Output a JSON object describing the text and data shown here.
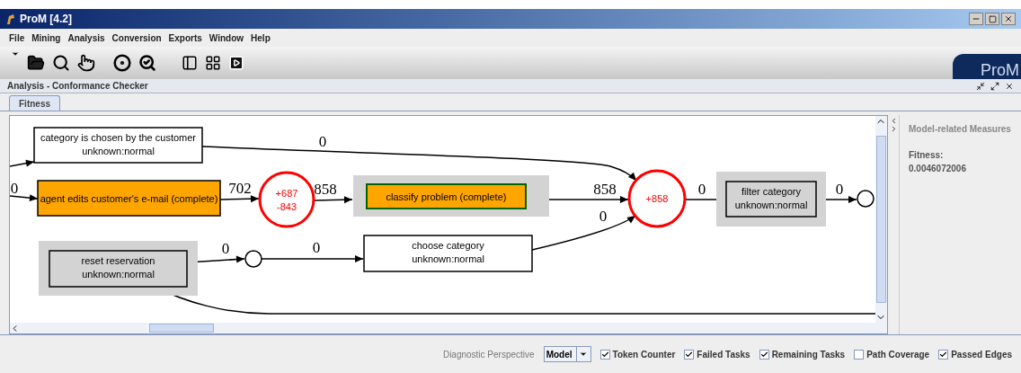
{
  "window": {
    "title": "ProM [4.2]"
  },
  "menu": [
    "File",
    "Mining",
    "Analysis",
    "Conversion",
    "Exports",
    "Window",
    "Help"
  ],
  "logo": "ProM",
  "frame": {
    "title": "Analysis - Conformance Checker"
  },
  "tabs": [
    {
      "label": "Fitness",
      "selected": true
    }
  ],
  "graph": {
    "transitions": [
      {
        "name": "category is chosen by the customer",
        "status": "unknown:normal",
        "failed": false,
        "remaining": false,
        "outlined": false
      },
      {
        "name": "agent edits customer's e-mail (complete)",
        "failed": true,
        "remaining": false,
        "outlined": false
      },
      {
        "name": "classify problem (complete)",
        "failed": true,
        "remaining": true,
        "outlined": true
      },
      {
        "name": "filter category",
        "status": "unknown:normal",
        "failed": false,
        "remaining": true,
        "outlined": false
      },
      {
        "name": "reset reservation",
        "status": "unknown:normal",
        "failed": false,
        "remaining": true,
        "outlined": false
      },
      {
        "name": "choose category",
        "status": "unknown:normal",
        "failed": false,
        "remaining": false,
        "outlined": false
      }
    ],
    "places": [
      {
        "tokens": [
          "+687",
          "-843"
        ],
        "problem": true
      },
      {
        "tokens": [
          "+858"
        ],
        "problem": true
      },
      {
        "problem": false
      },
      {
        "problem": false
      }
    ],
    "arcs": [
      {
        "label": "0"
      },
      {
        "label": "0"
      },
      {
        "label": "702"
      },
      {
        "label": "858"
      },
      {
        "label": "858"
      },
      {
        "label": "0"
      },
      {
        "label": "0"
      },
      {
        "label": "0"
      },
      {
        "label": "0"
      },
      {
        "label": "0"
      }
    ]
  },
  "side_panel": {
    "heading": "Model-related Measures",
    "metric_label": "Fitness:",
    "metric_value": "0.0046072006"
  },
  "options": {
    "perspective_label": "Diagnostic Perspective",
    "perspective": "Model",
    "checkboxes": [
      {
        "label": "Token Counter",
        "checked": true
      },
      {
        "label": "Failed Tasks",
        "checked": true
      },
      {
        "label": "Remaining Tasks",
        "checked": true
      },
      {
        "label": "Path Coverage",
        "checked": false
      },
      {
        "label": "Passed Edges",
        "checked": true
      }
    ]
  }
}
